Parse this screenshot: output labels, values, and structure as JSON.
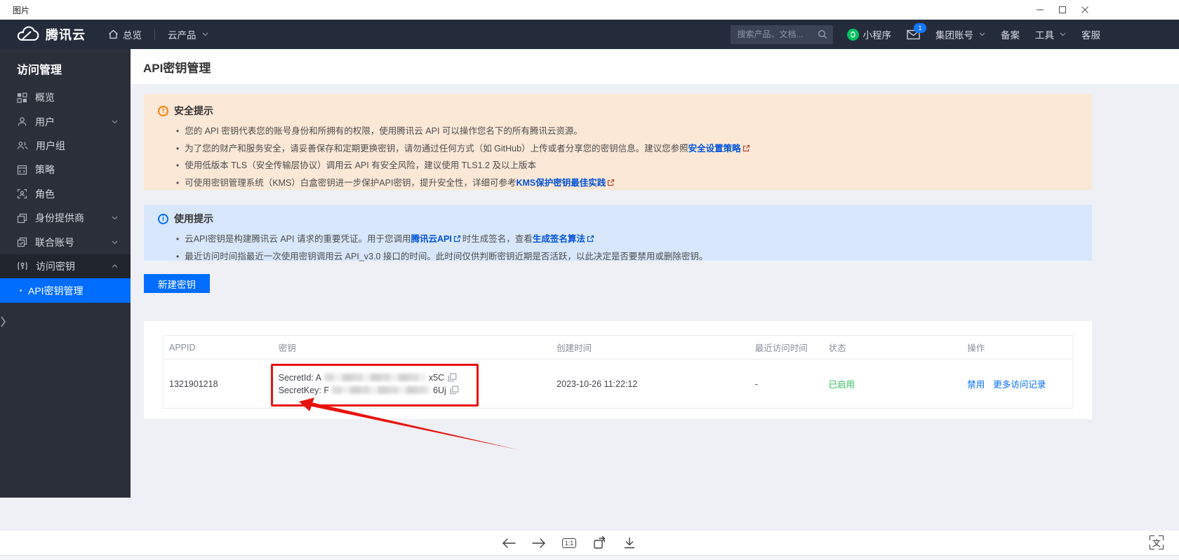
{
  "window": {
    "title": "图片"
  },
  "nav": {
    "brand": "腾讯云",
    "overview": "总览",
    "products": "云产品",
    "search_placeholder": "搜索产品、文档...",
    "mini_program": "小程序",
    "mail_badge": "1",
    "group_account": "集团账号",
    "beian": "备案",
    "tools": "工具",
    "support": "客服"
  },
  "sidebar": {
    "title": "访问管理",
    "items": [
      {
        "label": "概览"
      },
      {
        "label": "用户"
      },
      {
        "label": "用户组"
      },
      {
        "label": "策略"
      },
      {
        "label": "角色"
      },
      {
        "label": "身份提供商"
      },
      {
        "label": "联合账号"
      },
      {
        "label": "访问密钥"
      }
    ],
    "active_item": {
      "label": "API密钥管理"
    }
  },
  "page": {
    "title": "API密钥管理",
    "security_alert": {
      "title": "安全提示",
      "bullet1": "您的 API 密钥代表您的账号身份和所拥有的权限，使用腾讯云 API 可以操作您名下的所有腾讯云资源。",
      "bullet2_text": "为了您的财产和服务安全，请妥善保存和定期更换密钥，请勿通过任何方式（如 GitHub）上传或者分享您的密钥信息。建议您参照",
      "bullet2_link": "安全设置策略",
      "bullet3": "使用低版本 TLS（安全传输层协议）调用云 API 有安全风险，建议使用 TLS1.2 及以上版本",
      "bullet4_text": "可使用密钥管理系统（KMS）白盒密钥进一步保护API密钥，提升安全性，详细可参考",
      "bullet4_link": "KMS保护密钥最佳实践"
    },
    "usage_alert": {
      "title": "使用提示",
      "bullet1_pre": "云API密钥是构建腾讯云 API 请求的重要凭证。用于您调用",
      "bullet1_link1": "腾讯云API",
      "bullet1_mid": "时生成签名，查看",
      "bullet1_link2": "生成签名算法",
      "bullet2": "最近访问时间指最近一次使用密钥调用云 API_v3.0 接口的时间。此时间仅供判断密钥近期是否活跃，以此决定是否要禁用或删除密钥。"
    },
    "create_button": "新建密钥",
    "table": {
      "headers": [
        "APPID",
        "密钥",
        "创建时间",
        "最近访问时间",
        "状态",
        "操作"
      ],
      "row": {
        "appid": "1321901218",
        "secret_id_prefix": "SecretId: A",
        "secret_id_suffix": "x5C",
        "secret_key_prefix": "SecretKey: F",
        "secret_key_suffix": "6Uj",
        "created": "2023-10-26 11:22:12",
        "last_access": "-",
        "status": "已启用",
        "action_disable": "禁用",
        "action_more": "更多访问记录"
      }
    }
  },
  "viewer": {
    "actual_size": "1:1",
    "ocr_glyph": "文"
  },
  "colors": {
    "accent": "#006dff",
    "link": "#0052d9",
    "status_green": "#2fc25b",
    "annotation_red": "#e8120c",
    "security_alert_bg": "#fbe8d7",
    "usage_alert_bg": "#d8e7fb",
    "nav_bg": "#242c3c",
    "sidebar_bg": "#2a2f39"
  }
}
